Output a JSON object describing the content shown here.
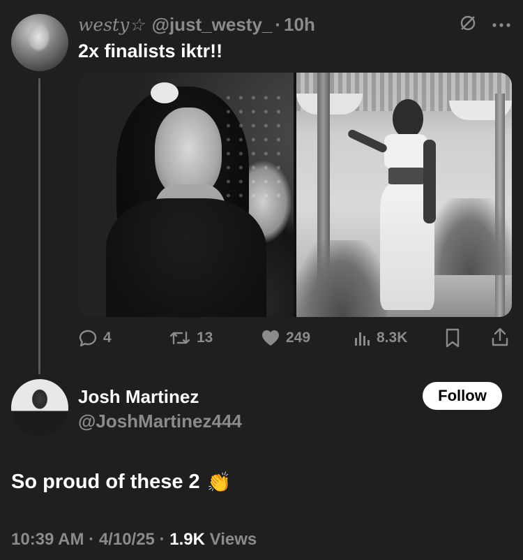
{
  "original_tweet": {
    "display_name": "westy☆",
    "handle": "@just_westy_",
    "separator": "·",
    "time": "10h",
    "text": "2x finalists iktr!!",
    "photos": [
      "photo-woman-black-dress",
      "photo-woman-white-outfit"
    ],
    "actions": {
      "replies": "4",
      "reposts": "13",
      "likes": "249",
      "views": "8.3K"
    }
  },
  "reply": {
    "display_name": "Josh Martinez",
    "handle": "@JoshMartinez444",
    "follow_label": "Follow",
    "text": "So proud of these 2",
    "emoji": "👏",
    "time": "10:39 AM",
    "sep1": "·",
    "date": "4/10/25",
    "sep2": "·",
    "views_count": "1.9K",
    "views_label": "Views"
  },
  "icons": [
    "grok-icon",
    "more-icon",
    "reply-icon",
    "repost-icon",
    "like-icon",
    "views-icon",
    "bookmark-icon",
    "share-icon",
    "clap-emoji"
  ],
  "colors": {
    "background": "#1f1f1f",
    "text_primary": "#ffffff",
    "text_secondary": "#8b8b8b",
    "thread_line": "#5a5a5a",
    "follow_bg": "#ffffff"
  }
}
